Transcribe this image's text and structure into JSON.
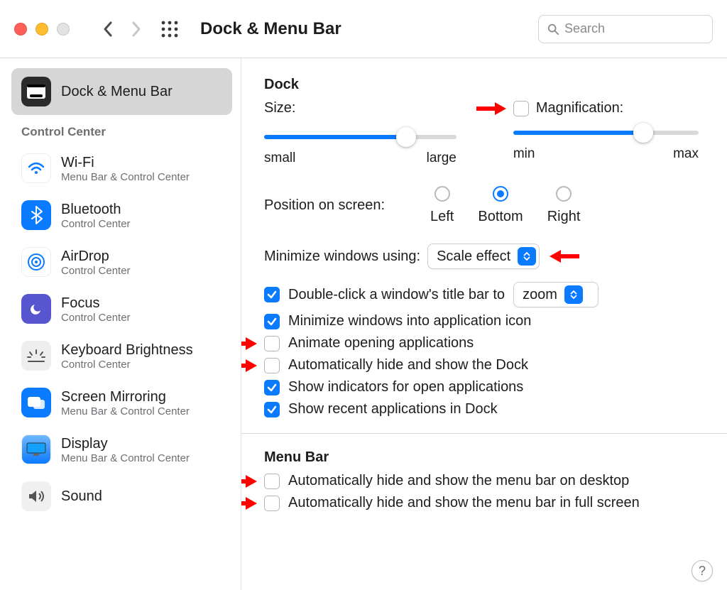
{
  "toolbar": {
    "title": "Dock & Menu Bar",
    "search_placeholder": "Search"
  },
  "sidebar": {
    "selected": {
      "label": "Dock & Menu Bar"
    },
    "section_header": "Control Center",
    "items": [
      {
        "label": "Wi-Fi",
        "sub": "Menu Bar & Control Center"
      },
      {
        "label": "Bluetooth",
        "sub": "Control Center"
      },
      {
        "label": "AirDrop",
        "sub": "Control Center"
      },
      {
        "label": "Focus",
        "sub": "Control Center"
      },
      {
        "label": "Keyboard Brightness",
        "sub": "Control Center"
      },
      {
        "label": "Screen Mirroring",
        "sub": "Menu Bar & Control Center"
      },
      {
        "label": "Display",
        "sub": "Menu Bar & Control Center"
      },
      {
        "label": "Sound",
        "sub": ""
      }
    ]
  },
  "dock": {
    "heading": "Dock",
    "size_label": "Size:",
    "size_min": "small",
    "size_max": "large",
    "mag_label": "Magnification:",
    "mag_min": "min",
    "mag_max": "max",
    "position_label": "Position on screen:",
    "pos_left": "Left",
    "pos_bottom": "Bottom",
    "pos_right": "Right",
    "position_selected": "Bottom",
    "minimize_label": "Minimize windows using:",
    "minimize_value": "Scale effect",
    "dbl_click_prefix": "Double-click a window's title bar to",
    "dbl_click_value": "zoom",
    "minimize_into_icon": "Minimize windows into application icon",
    "animate": "Animate opening applications",
    "auto_hide": "Automatically hide and show the Dock",
    "indicators": "Show indicators for open applications",
    "recent": "Show recent applications in Dock"
  },
  "menubar": {
    "heading": "Menu Bar",
    "auto_hide_desktop": "Automatically hide and show the menu bar on desktop",
    "auto_hide_fullscreen": "Automatically hide and show the menu bar in full screen"
  },
  "colors": {
    "accent": "#0a7aff",
    "annotation": "#ff0000"
  }
}
